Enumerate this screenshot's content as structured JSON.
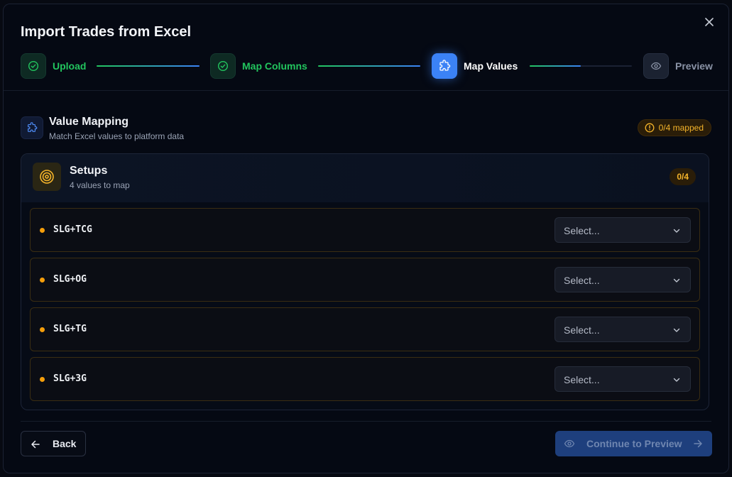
{
  "dialog": {
    "title": "Import Trades from Excel",
    "close_icon": "close-icon"
  },
  "stepper": {
    "steps": [
      {
        "label": "Upload",
        "state": "done",
        "icon": "check-circle-icon"
      },
      {
        "label": "Map Columns",
        "state": "done",
        "icon": "check-circle-icon"
      },
      {
        "label": "Map Values",
        "state": "active",
        "icon": "puzzle-icon"
      },
      {
        "label": "Preview",
        "state": "todo",
        "icon": "eye-icon"
      }
    ],
    "progress_to_preview": 0.5
  },
  "value_mapping": {
    "title": "Value Mapping",
    "subtitle": "Match Excel values to platform data",
    "mapped_badge": "0/4 mapped",
    "icon": "puzzle-icon"
  },
  "setups": {
    "title": "Setups",
    "subtitle": "4 values to map",
    "count_badge": "0/4",
    "icon": "target-icon",
    "rows": [
      {
        "value": "SLG+TCG",
        "select_placeholder": "Select..."
      },
      {
        "value": "SLG+OG",
        "select_placeholder": "Select..."
      },
      {
        "value": "SLG+TG",
        "select_placeholder": "Select..."
      },
      {
        "value": "SLG+3G",
        "select_placeholder": "Select..."
      }
    ]
  },
  "footer": {
    "back_label": "Back",
    "continue_label": "Continue to Preview"
  },
  "colors": {
    "success": "#22c55e",
    "accent": "#3b82f6",
    "warning": "#f5b42a",
    "background": "#050913"
  }
}
